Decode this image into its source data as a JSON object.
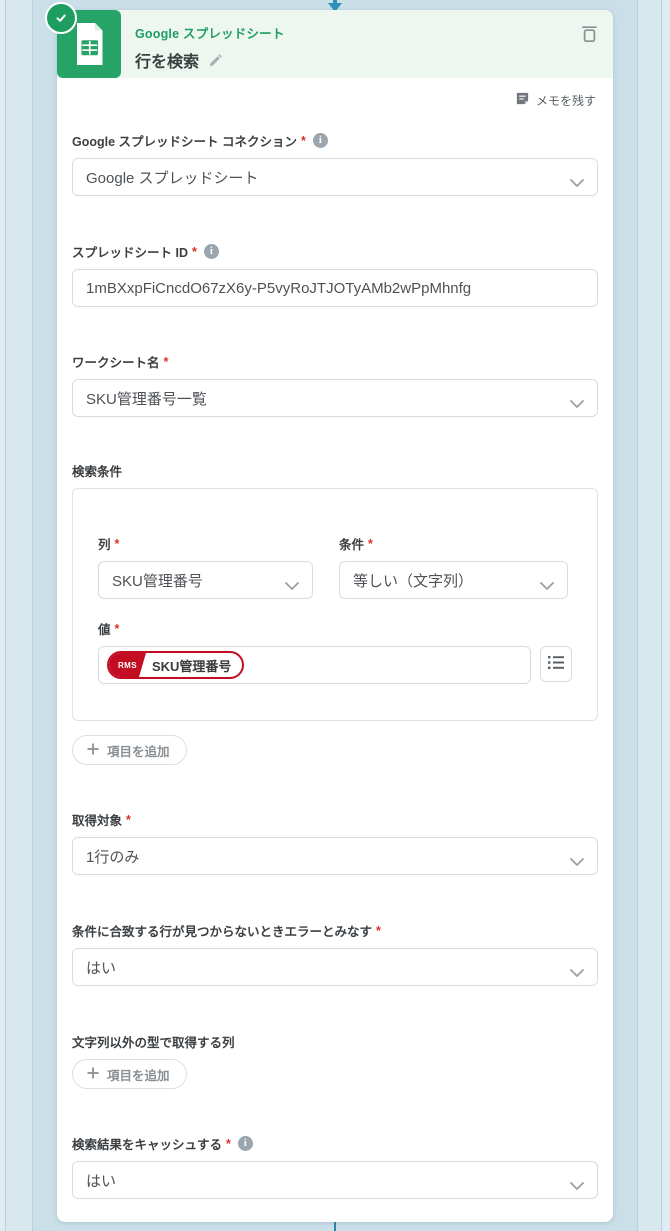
{
  "ui": {
    "required_mark": "*",
    "add_item_label": "項目を追加",
    "memo_label": "メモを残す",
    "info_glyph": "i"
  },
  "header": {
    "app_label": "Google スプレッドシート",
    "title": "行を検索"
  },
  "fields": {
    "connection": {
      "label": "Google スプレッドシート コネクション",
      "value": "Google スプレッドシート"
    },
    "spreadsheet_id": {
      "label": "スプレッドシート ID",
      "value": "1mBXxpFiCncdO67zX6y-P5vyRoJTJOTyAMb2wPpMhnfg"
    },
    "worksheet": {
      "label": "ワークシート名",
      "value": "SKU管理番号一覧"
    },
    "search_conditions": {
      "section_label": "検索条件",
      "column": {
        "label": "列",
        "value": "SKU管理番号"
      },
      "condition": {
        "label": "条件",
        "value": "等しい（文字列）"
      },
      "value_field": {
        "label": "値",
        "token": {
          "badge": "RMS",
          "text": "SKU管理番号"
        }
      }
    },
    "target": {
      "label": "取得対象",
      "value": "1行のみ"
    },
    "error_if_not_found": {
      "label": "条件に合致する行が見つからないときエラーとみなす",
      "value": "はい"
    },
    "non_string_columns": {
      "label": "文字列以外の型で取得する列"
    },
    "cache": {
      "label": "検索結果をキャッシュする",
      "value": "はい"
    }
  },
  "icons": {
    "check-icon": "✓",
    "edit-icon": "✎",
    "trash-icon": "trash outline",
    "memo-icon": "note with pencil",
    "info-icon": "i in circle",
    "chevron-down-icon": "⌄",
    "plus-icon": "＋",
    "list-icon": "bulleted list",
    "arrow-down-icon": "▼"
  },
  "colors": {
    "brand_green": "#26a366",
    "header_bg": "#edf6ef",
    "token_red": "#c30d23",
    "canvas_blue": "#cbdfe9",
    "connector_teal": "#2e93b6",
    "required_red": "#d93025"
  }
}
